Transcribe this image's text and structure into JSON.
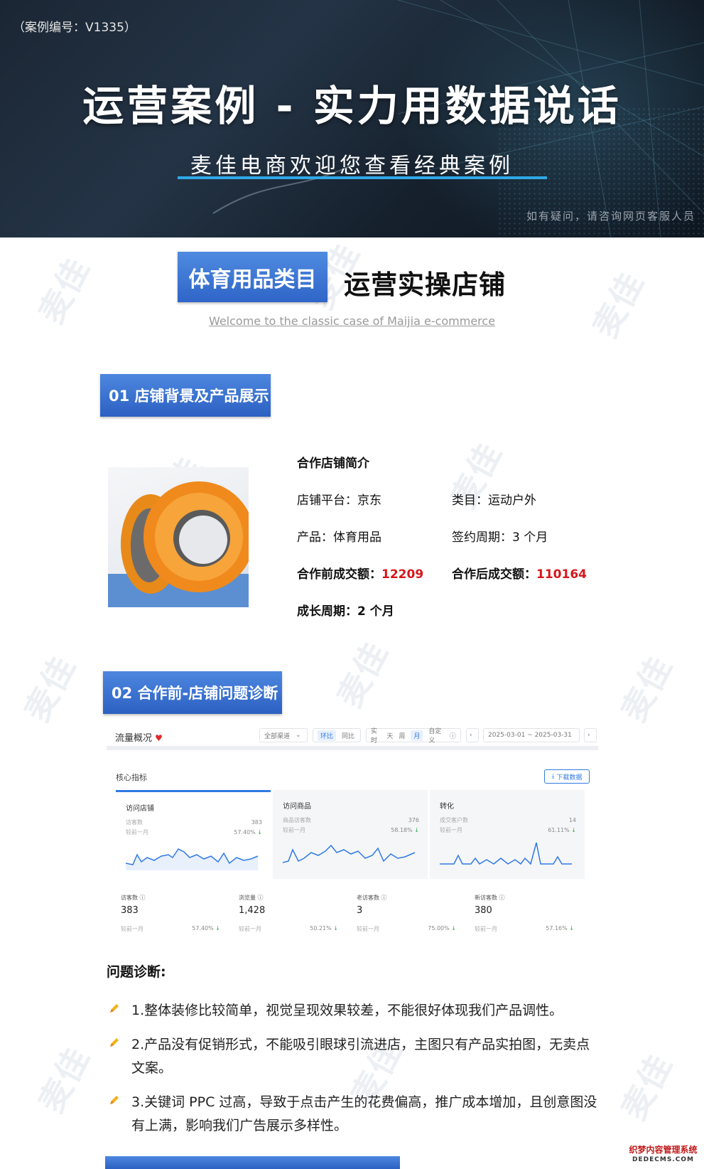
{
  "hero": {
    "case_id": "（案例编号：V1335）",
    "title": "运营案例 - 实力用数据说话",
    "subtitle": "麦佳电商欢迎您查看经典案例",
    "note": "如有疑问，请咨询网页客服人员"
  },
  "category": {
    "badge": "体育用品类目",
    "title": "运营实操店铺",
    "welcome": "Welcome to the classic case of Maijia e-commerce"
  },
  "section1": {
    "label": "01 店铺背景及产品展示"
  },
  "shop": {
    "intro_title": "合作店铺简介",
    "platform": "店铺平台：京东",
    "category": "类目：运动户外",
    "product": "产品：体育用品",
    "contract": "签约周期：3 个月",
    "before_label": "合作前成交额：",
    "before_value": "12209",
    "after_label": "合作后成交额：",
    "after_value": "110164",
    "growth": "成长周期：2 个月"
  },
  "section2": {
    "label": "02 合作前-店铺问题诊断"
  },
  "dashboard": {
    "title": "流量概况",
    "channel": "全部渠道",
    "compare_on": "环比",
    "compare_off": "同比",
    "periods": [
      "实时",
      "天",
      "周",
      "月",
      "自定义"
    ],
    "period_active": "月",
    "date_range": "2025-03-01 ~ 2025-03-31",
    "core_label": "核心指标",
    "download": "下载数据",
    "cards": [
      {
        "title": "访问店铺",
        "sub1": "访客数",
        "sub2": "较前一月",
        "val": "383",
        "pct": "57.40%"
      },
      {
        "title": "访问商品",
        "sub1": "商品访客数",
        "sub2": "较前一月",
        "val": "376",
        "pct": "58.18%"
      },
      {
        "title": "转化",
        "sub1": "成交客户数",
        "sub2": "较前一月",
        "val": "14",
        "pct": "61.11%"
      }
    ],
    "stats": [
      {
        "name": "访客数",
        "num": "383",
        "cmp": "较前一月",
        "pct": "57.40%"
      },
      {
        "name": "浏览量",
        "num": "1,428",
        "cmp": "较前一月",
        "pct": "50.21%"
      },
      {
        "name": "老访客数",
        "num": "3",
        "cmp": "较前一月",
        "pct": "75.00%"
      },
      {
        "name": "新访客数",
        "num": "380",
        "cmp": "较前一月",
        "pct": "57.16%"
      }
    ]
  },
  "diagnosis": {
    "title": "问题诊断:",
    "items": [
      "1.整体装修比较简单，视觉呈现效果较差，不能很好体现我们产品调性。",
      "2.产品没有促销形式，不能吸引眼球引流进店，主图只有产品实拍图，无卖点文案。",
      "3.关键词 PPC 过高，导致于点击产生的花费偏高，推广成本增加，且创意图没有上满，影响我们广告展示多样性。"
    ]
  },
  "watermark": "麦佳",
  "footer_logo": {
    "cn": "织梦内容管理系统",
    "en": "DEDECMS.COM"
  },
  "colors": {
    "accent_blue": "#2f65c8",
    "highlight_red": "#d8151b",
    "hero_line": "#2fa8e6"
  }
}
